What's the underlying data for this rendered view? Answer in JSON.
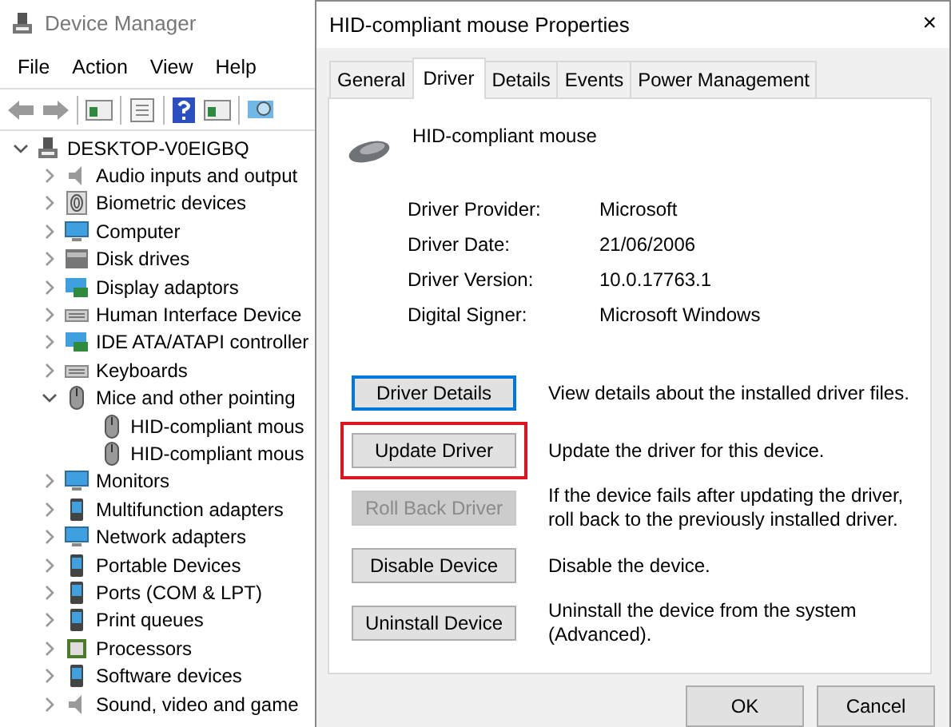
{
  "device_manager": {
    "title": "Device Manager",
    "menu": [
      "File",
      "Action",
      "View",
      "Help"
    ],
    "tree": [
      {
        "label": "DESKTOP-V0EIGBQ",
        "expanded": true,
        "children": [
          {
            "label": "Audio inputs and output",
            "expanded": false
          },
          {
            "label": "Biometric devices",
            "expanded": false
          },
          {
            "label": "Computer",
            "expanded": false
          },
          {
            "label": "Disk drives",
            "expanded": false
          },
          {
            "label": "Display adaptors",
            "expanded": false
          },
          {
            "label": "Human Interface Device",
            "expanded": false
          },
          {
            "label": "IDE ATA/ATAPI controller",
            "expanded": false
          },
          {
            "label": "Keyboards",
            "expanded": false
          },
          {
            "label": "Mice and other pointing",
            "expanded": true,
            "children": [
              {
                "label": "HID-compliant mous"
              },
              {
                "label": "HID-compliant mous"
              }
            ]
          },
          {
            "label": "Monitors",
            "expanded": false
          },
          {
            "label": "Multifunction adapters",
            "expanded": false
          },
          {
            "label": "Network adapters",
            "expanded": false
          },
          {
            "label": "Portable Devices",
            "expanded": false
          },
          {
            "label": "Ports (COM & LPT)",
            "expanded": false
          },
          {
            "label": "Print queues",
            "expanded": false
          },
          {
            "label": "Processors",
            "expanded": false
          },
          {
            "label": "Software devices",
            "expanded": false
          },
          {
            "label": "Sound, video and game",
            "expanded": false
          }
        ]
      }
    ]
  },
  "dialog": {
    "title": "HID-compliant mouse Properties",
    "close": "×",
    "tabs": [
      {
        "label": "General",
        "selected": false
      },
      {
        "label": "Driver",
        "selected": true
      },
      {
        "label": "Details",
        "selected": false
      },
      {
        "label": "Events",
        "selected": false
      },
      {
        "label": "Power Management",
        "selected": false
      }
    ],
    "device_name": "HID-compliant mouse",
    "properties": [
      {
        "label": "Driver Provider:",
        "value": "Microsoft"
      },
      {
        "label": "Driver Date:",
        "value": "21/06/2006"
      },
      {
        "label": "Driver Version:",
        "value": "10.0.17763.1"
      },
      {
        "label": "Digital Signer:",
        "value": "Microsoft Windows"
      }
    ],
    "actions": [
      {
        "button": "Driver Details",
        "description": "View details about the installed driver files.",
        "focused": true,
        "disabled": false,
        "highlighted": false
      },
      {
        "button": "Update Driver",
        "description": "Update the driver for this device.",
        "focused": false,
        "disabled": false,
        "highlighted": true
      },
      {
        "button": "Roll Back Driver",
        "description": "If the device fails after updating the driver, roll back to the previously installed driver.",
        "focused": false,
        "disabled": true,
        "highlighted": false
      },
      {
        "button": "Disable Device",
        "description": "Disable the device.",
        "focused": false,
        "disabled": false,
        "highlighted": false
      },
      {
        "button": "Uninstall Device",
        "description": "Uninstall the device from the system (Advanced).",
        "focused": false,
        "disabled": false,
        "highlighted": false
      }
    ],
    "buttons": [
      "OK",
      "Cancel"
    ]
  }
}
